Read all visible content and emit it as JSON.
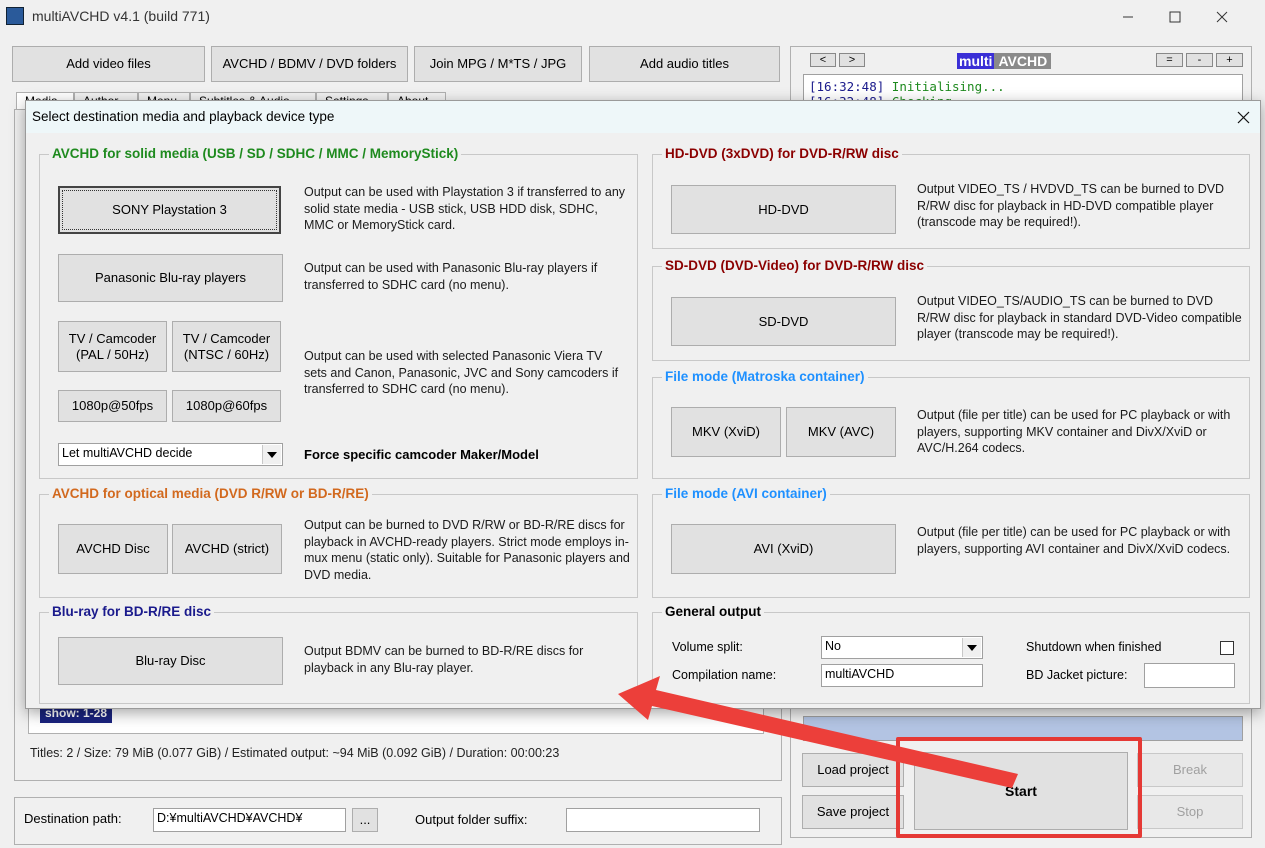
{
  "window": {
    "title": "multiAVCHD v4.1 (build 771)"
  },
  "toolbar": {
    "add_video": "Add video files",
    "avchd_folders": "AVCHD / BDMV / DVD folders",
    "join": "Join MPG / M*TS / JPG",
    "add_audio": "Add audio titles"
  },
  "tabs": [
    "Media",
    "Author",
    "Menu",
    "Subtitles & Audio",
    "Settings",
    "About"
  ],
  "right_panel": {
    "nav_prev": "<",
    "nav_next": ">",
    "logo_left": "multi",
    "logo_right": "AVCHD",
    "size_buttons": [
      "=",
      "-",
      "+"
    ],
    "log": [
      {
        "time": "[16:32:48]",
        "text": "Initialising..."
      },
      {
        "time": "[16:32:48]",
        "text": "Checking..."
      }
    ]
  },
  "status": {
    "summary": "Titles: 2 / Size: 79 MiB (0.077 GiB) / Estimated output: ~94 MiB (0.092 GiB) / Duration: 00:00:23",
    "show_badge": "show: 1-28"
  },
  "bottom": {
    "destination_label": "Destination path:",
    "destination_value": "D:¥multiAVCHD¥AVCHD¥",
    "browse": "...",
    "suffix_label": "Output folder suffix:",
    "suffix_value": ""
  },
  "actions": {
    "load_project": "Load project",
    "save_project": "Save project",
    "start": "Start",
    "break": "Break",
    "stop": "Stop"
  },
  "dialog": {
    "title": "Select destination media and playback device type",
    "close": "✕",
    "colors": {
      "avchd_solid": "#1e8a1e",
      "avchd_optical": "#d2691e",
      "bluray": "#1a1a8c",
      "hddvd": "#8b0000",
      "sddvd": "#8b0000",
      "file_mode": "#1e90ff",
      "general": "#000000"
    },
    "avchd_solid": {
      "title": "AVCHD for solid media (USB / SD / SDHC / MMC / MemoryStick)",
      "ps3": "SONY Playstation 3",
      "ps3_desc": "Output can be used with Playstation 3 if transferred to any solid state media - USB stick, USB HDD disk, SDHC, MMC or MemoryStick card.",
      "panasonic": "Panasonic Blu-ray players",
      "panasonic_desc": "Output can be used with Panasonic Blu-ray players if transferred to SDHC card (no menu).",
      "tv_pal": "TV / Camcoder (PAL / 50Hz)",
      "tv_ntsc": "TV / Camcoder (NTSC / 60Hz)",
      "tv_desc": "Output can be used with selected Panasonic Viera TV sets and Canon, Panasonic, JVC and Sony camcoders if transferred to SDHC card (no menu).",
      "p50": "1080p@50fps",
      "p60": "1080p@60fps",
      "maker_select": "Let multiAVCHD decide",
      "maker_label": "Force specific camcoder Maker/Model"
    },
    "avchd_optical": {
      "title": "AVCHD for optical media (DVD R/RW or BD-R/RE)",
      "disc": "AVCHD Disc",
      "strict": "AVCHD (strict)",
      "desc": "Output can be burned to DVD R/RW or BD-R/RE discs for playback in AVCHD-ready players. Strict mode employs in-mux menu (static only). Suitable for Panasonic players and DVD media."
    },
    "bluray": {
      "title": "Blu-ray for BD-R/RE disc",
      "disc": "Blu-ray Disc",
      "desc": "Output BDMV can be burned to BD-R/RE discs for playback in any Blu-ray player."
    },
    "hddvd": {
      "title": "HD-DVD (3xDVD) for DVD-R/RW disc",
      "button": "HD-DVD",
      "desc": "Output VIDEO_TS / HVDVD_TS can be burned to DVD R/RW disc for playback in HD-DVD compatible player (transcode may be required!)."
    },
    "sddvd": {
      "title": "SD-DVD (DVD-Video) for DVD-R/RW disc",
      "button": "SD-DVD",
      "desc": "Output VIDEO_TS/AUDIO_TS can be burned to DVD R/RW disc for playback in standard DVD-Video compatible player (transcode may be required!)."
    },
    "mkv": {
      "title": "File mode (Matroska container)",
      "xvid": "MKV (XviD)",
      "avc": "MKV (AVC)",
      "desc": "Output (file per title) can be used for PC playback or with players, supporting MKV container and DivX/XviD or AVC/H.264 codecs."
    },
    "avi": {
      "title": "File mode (AVI container)",
      "button": "AVI (XviD)",
      "desc": "Output (file per title) can be used for PC playback or with players, supporting AVI container and DivX/XviD codecs."
    },
    "general": {
      "title": "General output",
      "volume_split_label": "Volume split:",
      "volume_split_value": "No",
      "compilation_label": "Compilation name:",
      "compilation_value": "multiAVCHD",
      "shutdown_label": "Shutdown when finished",
      "jacket_label": "BD Jacket picture:",
      "jacket_value": ""
    }
  }
}
